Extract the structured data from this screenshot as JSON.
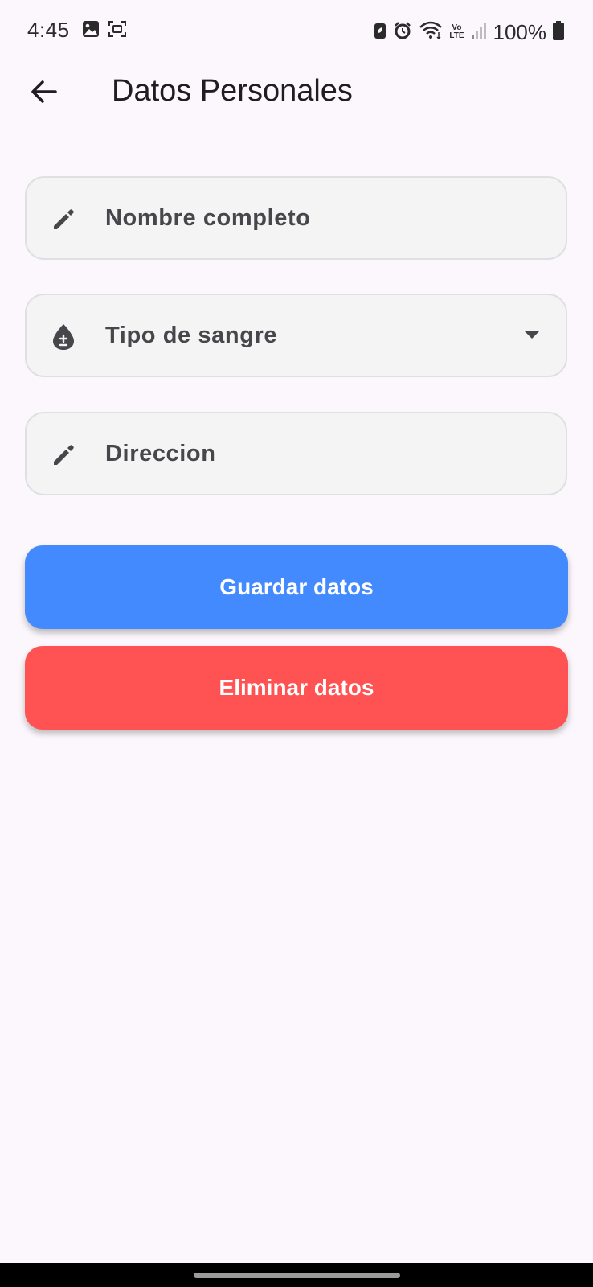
{
  "status_bar": {
    "time": "4:45",
    "battery_percent": "100%",
    "icons": [
      "gallery-icon",
      "screen-capture-icon",
      "battery-saver-icon",
      "alarm-icon",
      "wifi-icon",
      "volte-icon",
      "signal-icon",
      "battery-icon"
    ],
    "volte_top": "Vo",
    "volte_bottom": "LTE"
  },
  "app_bar": {
    "title": "Datos Personales",
    "back_icon": "arrow-back-icon"
  },
  "form": {
    "name_field": {
      "label": "Nombre completo",
      "icon": "pencil-icon"
    },
    "blood_type_field": {
      "label": "Tipo de sangre",
      "icon": "blood-drop-icon",
      "dropdown_icon": "dropdown-arrow-icon"
    },
    "address_field": {
      "label": "Direccion",
      "icon": "pencil-icon"
    }
  },
  "actions": {
    "save_label": "Guardar datos",
    "delete_label": "Eliminar datos",
    "save_color": "#448aff",
    "delete_color": "#ff5252"
  },
  "colors": {
    "background": "#fcf7fc",
    "field_fill": "#f4f4f4",
    "field_border": "#e0dfe2",
    "label_text": "#47464b"
  }
}
